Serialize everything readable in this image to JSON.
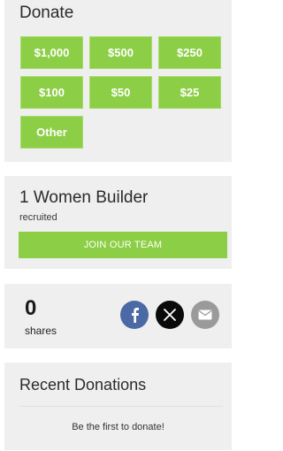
{
  "donate": {
    "title": "Donate",
    "amounts": [
      "$1,000",
      "$500",
      "$250",
      "$100",
      "$50",
      "$25",
      "Other"
    ]
  },
  "builder": {
    "title": "1 Women Builder",
    "subtitle": "recruited",
    "join_label": "JOIN OUR TEAM"
  },
  "shares": {
    "count": "0",
    "label": "shares",
    "icons": [
      "facebook-icon",
      "x-icon",
      "email-icon"
    ]
  },
  "recent": {
    "title": "Recent Donations",
    "empty_text": "Be the first to donate!"
  },
  "colors": {
    "accent_green": "#8cce45",
    "card_bg": "#efefef",
    "facebook_blue": "#4b69a5",
    "x_black": "#0a0a0a",
    "email_gray": "#9a9a9a"
  }
}
